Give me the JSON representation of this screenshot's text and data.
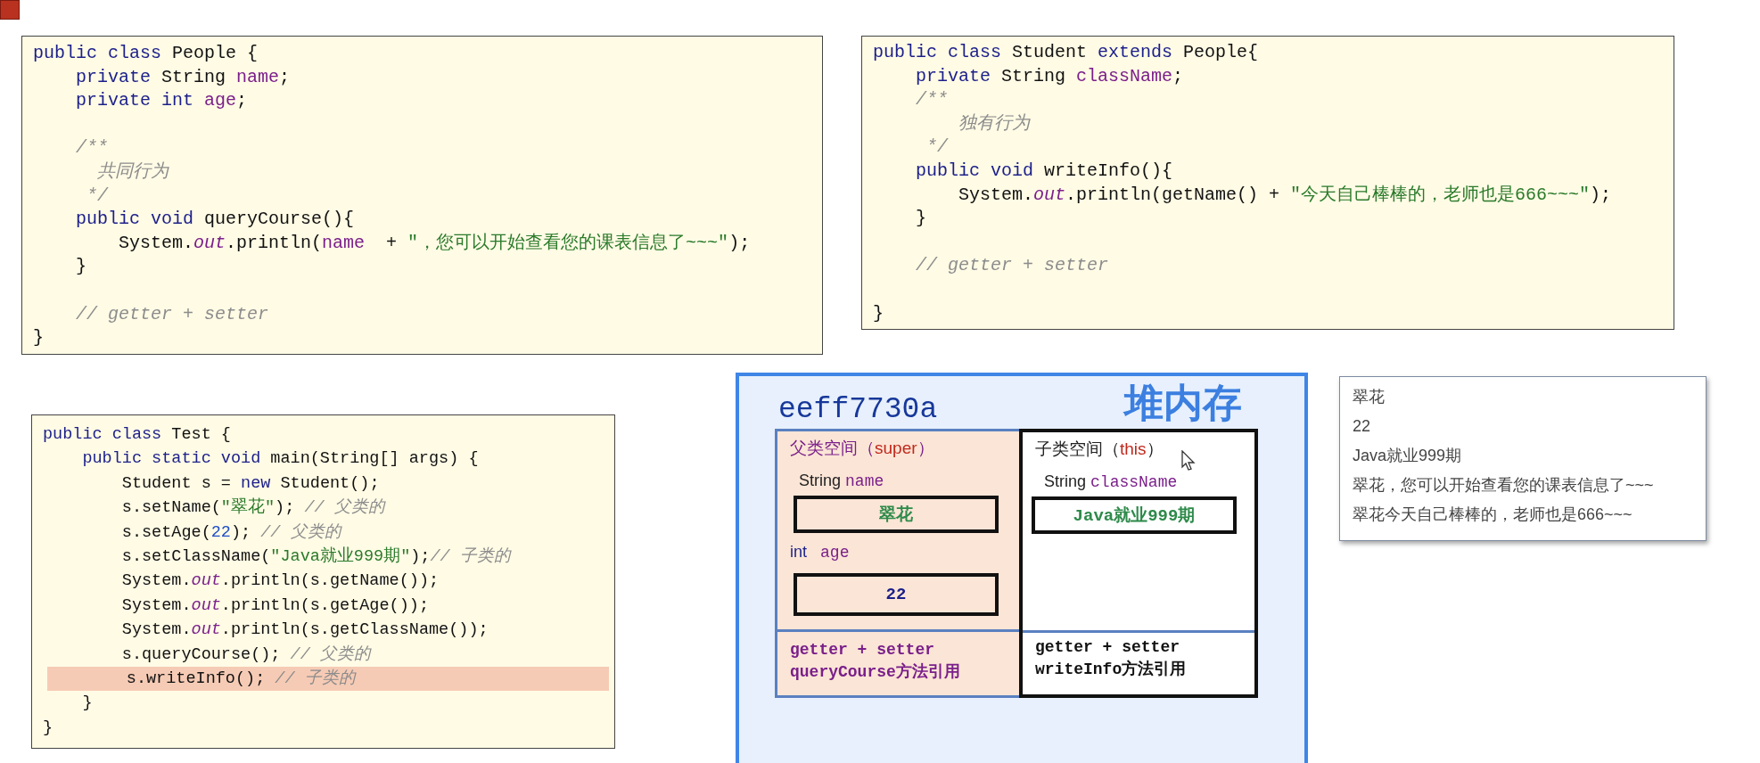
{
  "people_code": {
    "lines": [
      {
        "kind": "code",
        "tokens": [
          {
            "kind": "kw",
            "text": "public class "
          },
          {
            "kind": "plain",
            "text": "People {"
          }
        ]
      },
      {
        "kind": "code",
        "tokens": [
          {
            "kind": "kw",
            "text": "    private "
          },
          {
            "kind": "plain",
            "text": "String "
          },
          {
            "kind": "field",
            "text": "name"
          },
          {
            "kind": "plain",
            "text": ";"
          }
        ]
      },
      {
        "kind": "code",
        "tokens": [
          {
            "kind": "kw",
            "text": "    private int "
          },
          {
            "kind": "field",
            "text": "age"
          },
          {
            "kind": "plain",
            "text": ";"
          }
        ]
      },
      {
        "kind": "blank"
      },
      {
        "kind": "code",
        "tokens": [
          {
            "kind": "comment",
            "text": "    /**"
          }
        ]
      },
      {
        "kind": "code",
        "tokens": [
          {
            "kind": "comment",
            "text": "      共同行为"
          }
        ]
      },
      {
        "kind": "code",
        "tokens": [
          {
            "kind": "comment",
            "text": "     */"
          }
        ]
      },
      {
        "kind": "code",
        "tokens": [
          {
            "kind": "kw",
            "text": "    public void "
          },
          {
            "kind": "plain",
            "text": "queryCourse(){"
          }
        ]
      },
      {
        "kind": "code",
        "tokens": [
          {
            "kind": "plain",
            "text": "        System."
          },
          {
            "kind": "static",
            "text": "out"
          },
          {
            "kind": "plain",
            "text": ".println("
          },
          {
            "kind": "field",
            "text": "name"
          },
          {
            "kind": "plain",
            "text": "  + "
          },
          {
            "kind": "string",
            "text": "\"，您可以开始查看您的课表信息了~~~\""
          },
          {
            "kind": "plain",
            "text": ");"
          }
        ]
      },
      {
        "kind": "code",
        "tokens": [
          {
            "kind": "plain",
            "text": "    }"
          }
        ]
      },
      {
        "kind": "blank"
      },
      {
        "kind": "code",
        "tokens": [
          {
            "kind": "comment",
            "text": "    // getter + setter"
          }
        ]
      },
      {
        "kind": "code",
        "tokens": [
          {
            "kind": "plain",
            "text": "}"
          }
        ]
      }
    ]
  },
  "student_code": {
    "lines": [
      {
        "kind": "code",
        "tokens": [
          {
            "kind": "kw",
            "text": "public class "
          },
          {
            "kind": "plain",
            "text": "Student "
          },
          {
            "kind": "kw",
            "text": "extends "
          },
          {
            "kind": "plain",
            "text": "People{"
          }
        ]
      },
      {
        "kind": "code",
        "tokens": [
          {
            "kind": "kw",
            "text": "    private "
          },
          {
            "kind": "plain",
            "text": "String "
          },
          {
            "kind": "field",
            "text": "className"
          },
          {
            "kind": "plain",
            "text": ";"
          }
        ]
      },
      {
        "kind": "code",
        "tokens": [
          {
            "kind": "comment",
            "text": "    /**"
          }
        ]
      },
      {
        "kind": "code",
        "tokens": [
          {
            "kind": "comment",
            "text": "        独有行为"
          }
        ]
      },
      {
        "kind": "code",
        "tokens": [
          {
            "kind": "comment",
            "text": "     */"
          }
        ]
      },
      {
        "kind": "code",
        "tokens": [
          {
            "kind": "kw",
            "text": "    public void "
          },
          {
            "kind": "plain",
            "text": "writeInfo(){"
          }
        ]
      },
      {
        "kind": "code",
        "tokens": [
          {
            "kind": "plain",
            "text": "        System."
          },
          {
            "kind": "static",
            "text": "out"
          },
          {
            "kind": "plain",
            "text": ".println(getName() + "
          },
          {
            "kind": "string",
            "text": "\"今天自己棒棒的，老师也是666~~~\""
          },
          {
            "kind": "plain",
            "text": ");"
          }
        ]
      },
      {
        "kind": "code",
        "tokens": [
          {
            "kind": "plain",
            "text": "    }"
          }
        ]
      },
      {
        "kind": "blank"
      },
      {
        "kind": "code",
        "tokens": [
          {
            "kind": "comment",
            "text": "    // getter + setter"
          }
        ]
      },
      {
        "kind": "blank"
      },
      {
        "kind": "code",
        "tokens": [
          {
            "kind": "plain",
            "text": "}"
          }
        ]
      }
    ]
  },
  "test_code": {
    "lines": [
      {
        "kind": "code",
        "highlighted": false,
        "tokens": [
          {
            "kind": "kw",
            "text": "public class "
          },
          {
            "kind": "plain",
            "text": "Test {"
          }
        ]
      },
      {
        "kind": "code",
        "highlighted": false,
        "tokens": [
          {
            "kind": "kw",
            "text": "    public static void "
          },
          {
            "kind": "plain",
            "text": "main(String[] args) {"
          }
        ]
      },
      {
        "kind": "code",
        "highlighted": false,
        "tokens": [
          {
            "kind": "plain",
            "text": "        Student s = "
          },
          {
            "kind": "kw",
            "text": "new "
          },
          {
            "kind": "plain",
            "text": "Student();"
          }
        ]
      },
      {
        "kind": "code",
        "highlighted": false,
        "tokens": [
          {
            "kind": "plain",
            "text": "        s.setName("
          },
          {
            "kind": "string",
            "text": "\"翠花\""
          },
          {
            "kind": "plain",
            "text": "); "
          },
          {
            "kind": "comment",
            "text": "// 父类的"
          }
        ]
      },
      {
        "kind": "code",
        "highlighted": false,
        "tokens": [
          {
            "kind": "plain",
            "text": "        s.setAge("
          },
          {
            "kind": "num",
            "text": "22"
          },
          {
            "kind": "plain",
            "text": "); "
          },
          {
            "kind": "comment",
            "text": "// 父类的"
          }
        ]
      },
      {
        "kind": "code",
        "highlighted": false,
        "tokens": [
          {
            "kind": "plain",
            "text": "        s.setClassName("
          },
          {
            "kind": "string",
            "text": "\"Java就业999期\""
          },
          {
            "kind": "plain",
            "text": ");"
          },
          {
            "kind": "comment",
            "text": "// 子类的"
          }
        ]
      },
      {
        "kind": "code",
        "highlighted": false,
        "tokens": [
          {
            "kind": "plain",
            "text": "        System."
          },
          {
            "kind": "static",
            "text": "out"
          },
          {
            "kind": "plain",
            "text": ".println(s.getName());"
          }
        ]
      },
      {
        "kind": "code",
        "highlighted": false,
        "tokens": [
          {
            "kind": "plain",
            "text": "        System."
          },
          {
            "kind": "static",
            "text": "out"
          },
          {
            "kind": "plain",
            "text": ".println(s.getAge());"
          }
        ]
      },
      {
        "kind": "code",
        "highlighted": false,
        "tokens": [
          {
            "kind": "plain",
            "text": "        System."
          },
          {
            "kind": "static",
            "text": "out"
          },
          {
            "kind": "plain",
            "text": ".println(s.getClassName());"
          }
        ]
      },
      {
        "kind": "code",
        "highlighted": false,
        "tokens": [
          {
            "kind": "plain",
            "text": "        s.queryCourse(); "
          },
          {
            "kind": "comment",
            "text": "// 父类的"
          }
        ]
      },
      {
        "kind": "code",
        "highlighted": true,
        "tokens": [
          {
            "kind": "plain",
            "text": "        s.writeInfo(); "
          },
          {
            "kind": "comment",
            "text": "// 子类的"
          }
        ]
      },
      {
        "kind": "code",
        "highlighted": false,
        "tokens": [
          {
            "kind": "plain",
            "text": "    }"
          }
        ]
      },
      {
        "kind": "code",
        "highlighted": false,
        "tokens": [
          {
            "kind": "plain",
            "text": "}"
          }
        ]
      }
    ]
  },
  "heap": {
    "address": "eeff7730a",
    "title": "堆内存",
    "parent_space": {
      "header": [
        {
          "kind": "label",
          "text": "父类空间（"
        },
        {
          "kind": "keyword",
          "text": "super"
        },
        {
          "kind": "label",
          "text": "）"
        }
      ],
      "fields": [
        {
          "kind": "text",
          "type": "String",
          "name": "name",
          "value": "翠花"
        },
        {
          "kind": "number",
          "type": "int",
          "name": "age",
          "value": "22"
        }
      ],
      "methods": [
        "getter + setter",
        "queryCourse方法引用"
      ]
    },
    "child_space": {
      "header": [
        {
          "kind": "label",
          "text": "子类空间（"
        },
        {
          "kind": "keyword",
          "text": "this"
        },
        {
          "kind": "label",
          "text": "）"
        }
      ],
      "fields": [
        {
          "kind": "text",
          "type": "String",
          "name": "className",
          "value": "Java就业999期"
        }
      ],
      "methods": [
        "getter + setter",
        "writeInfo方法引用"
      ]
    }
  },
  "console_output": {
    "lines": [
      "翠花",
      "22",
      "Java就业999期",
      "翠花，您可以开始查看您的课表信息了~~~",
      "翠花今天自己棒棒的，老师也是666~~~"
    ]
  }
}
